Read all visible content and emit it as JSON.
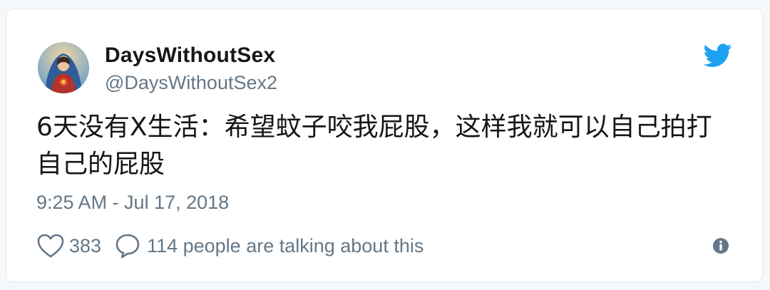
{
  "user": {
    "display_name": "DaysWithoutSex",
    "handle": "@DaysWithoutSex2",
    "avatar_icon": "virgin-mary-sacred-heart-avatar"
  },
  "tweet": {
    "text": "6天没有X生活：希望蚊子咬我屁股，这样我就可以自己拍打自己的屁股",
    "timestamp": "9:25 AM - Jul 17, 2018"
  },
  "actions": {
    "like_icon": "heart-icon",
    "like_count": "383",
    "reply_icon": "speech-bubble-icon",
    "reply_text": "114 people are talking about this",
    "info_icon": "info-icon"
  },
  "colors": {
    "brand": "#1da1f2",
    "secondary_text": "#657786",
    "primary_text": "#14171a"
  }
}
